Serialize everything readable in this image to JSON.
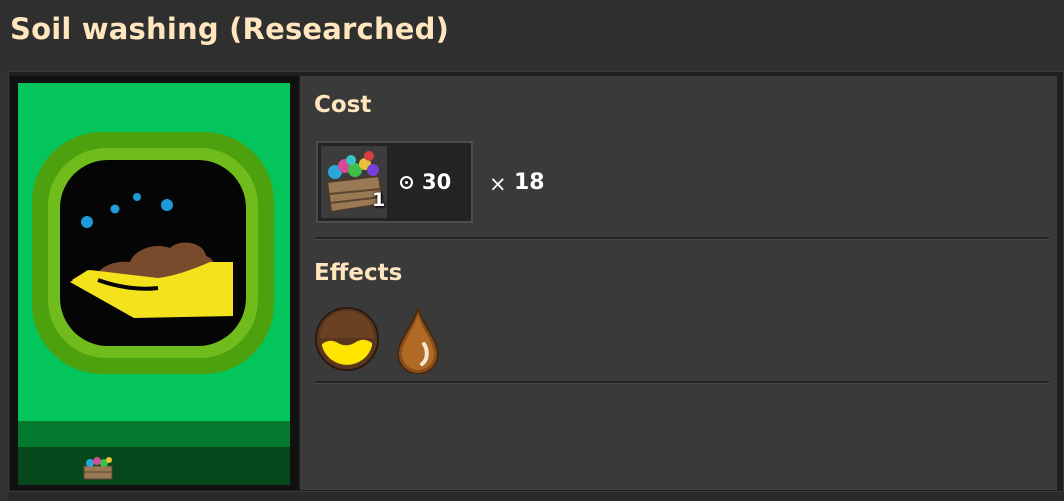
{
  "title": "Soil washing (Researched)",
  "tech_card": {
    "icon": "soil-washing-hand-icon",
    "ingredient_icon": "science-pack-crate-icon",
    "colors": {
      "background": "#04c45c",
      "band": "#047a2e",
      "bottom": "#06481c"
    }
  },
  "cost": {
    "heading": "Cost",
    "ingredient": {
      "icon": "science-pack-crate-icon",
      "count": "1"
    },
    "time": "30",
    "time_icon": "clock-icon",
    "multiplier_symbol": "×",
    "multiplier": "18"
  },
  "effects": {
    "heading": "Effects",
    "items": [
      {
        "icon": "dirt-yellow-wash-icon"
      },
      {
        "icon": "muddy-water-drop-icon"
      }
    ]
  }
}
